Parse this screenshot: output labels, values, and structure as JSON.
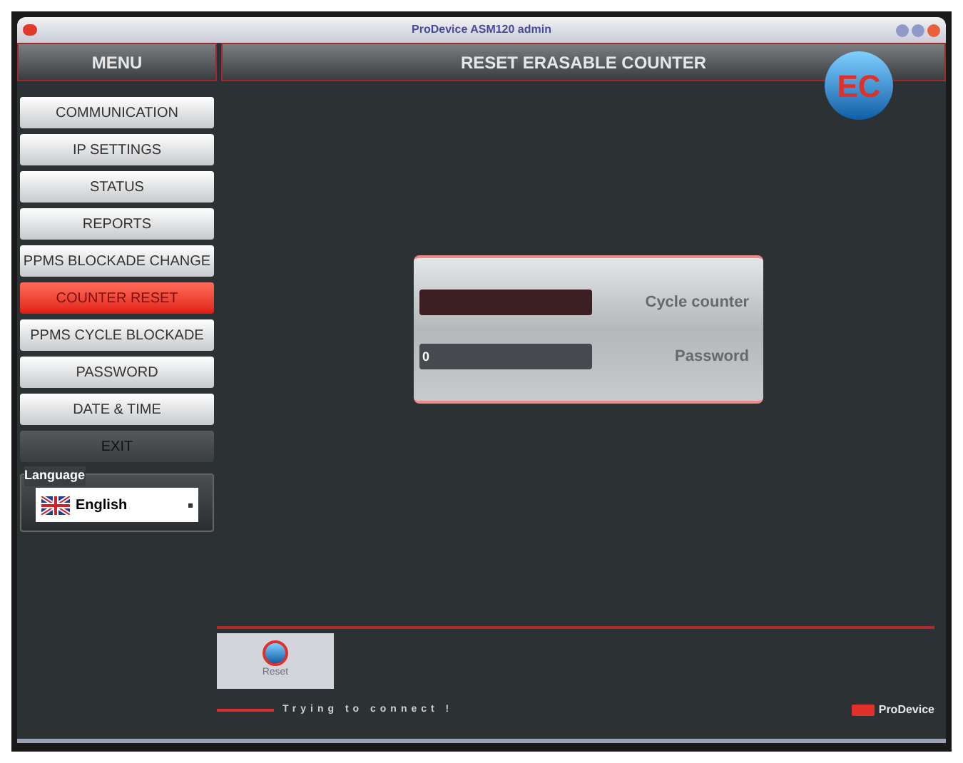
{
  "window": {
    "title": "ProDevice ASM120 admin"
  },
  "menu": {
    "title": "MENU",
    "items": [
      {
        "label": "COMMUNICATION",
        "selected": false,
        "kind": "nav"
      },
      {
        "label": "IP SETTINGS",
        "selected": false,
        "kind": "nav"
      },
      {
        "label": "STATUS",
        "selected": false,
        "kind": "nav"
      },
      {
        "label": "REPORTS",
        "selected": false,
        "kind": "nav"
      },
      {
        "label": "PPMS BLOCKADE CHANGE",
        "selected": false,
        "kind": "nav"
      },
      {
        "label": "COUNTER RESET",
        "selected": true,
        "kind": "nav"
      },
      {
        "label": "PPMS CYCLE BLOCKADE",
        "selected": false,
        "kind": "nav"
      },
      {
        "label": "PASSWORD",
        "selected": false,
        "kind": "nav"
      },
      {
        "label": "DATE & TIME",
        "selected": false,
        "kind": "nav"
      },
      {
        "label": "EXIT",
        "selected": false,
        "kind": "exit"
      }
    ]
  },
  "language": {
    "label": "Language",
    "value": "English"
  },
  "page": {
    "title": "RESET ERASABLE COUNTER",
    "logo_text": "EC"
  },
  "form": {
    "fields": [
      {
        "label": "Cycle counter",
        "kind": "counter"
      },
      {
        "label": "Password",
        "value": "0",
        "kind": "password"
      }
    ]
  },
  "reset_button": {
    "label": "Reset",
    "disabled": true
  },
  "status": "Trying to connect !",
  "brand": "ProDevice"
}
